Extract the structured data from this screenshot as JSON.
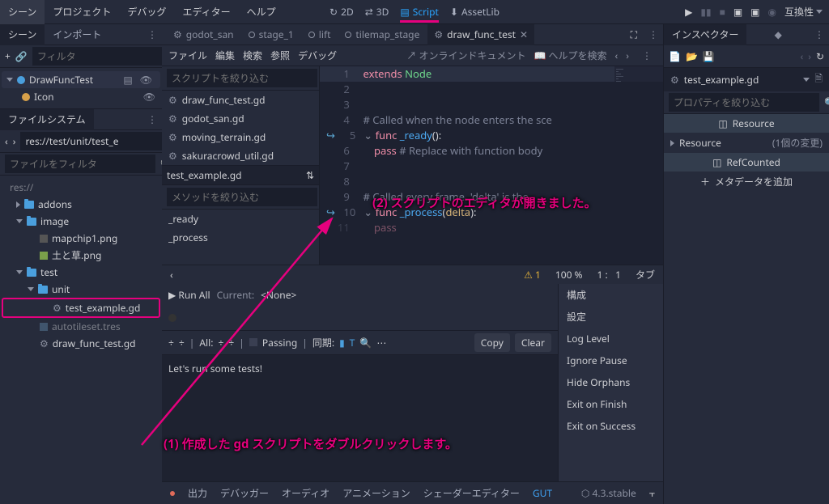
{
  "menu": [
    "シーン",
    "プロジェクト",
    "デバッグ",
    "エディター",
    "ヘルプ"
  ],
  "views": {
    "v2d": "2D",
    "v3d": "3D",
    "script": "Script",
    "assetlib": "AssetLib"
  },
  "compat": "互換性",
  "scene_panel": {
    "tab_scene": "シーン",
    "tab_import": "インポート",
    "filter_ph": "フィルタ",
    "nodes": [
      {
        "name": "DrawFuncTest",
        "icon": "node-blue",
        "sel": true
      },
      {
        "name": "Icon",
        "icon": "sprite",
        "sel": false
      }
    ]
  },
  "fs_panel": {
    "title": "ファイルシステム",
    "path": "res://test/unit/test_e",
    "filter_ph": "ファイルをフィルタ",
    "tree": [
      {
        "t": "folder",
        "name": "addons",
        "d": 1,
        "exp": false
      },
      {
        "t": "folder",
        "name": "image",
        "d": 1,
        "exp": true
      },
      {
        "t": "file",
        "name": "mapchip1.png",
        "d": 2
      },
      {
        "t": "file",
        "name": "土と草.png",
        "d": 2,
        "icon": "img"
      },
      {
        "t": "folder",
        "name": "test",
        "d": 1,
        "exp": true
      },
      {
        "t": "folder",
        "name": "unit",
        "d": 2,
        "exp": true
      },
      {
        "t": "file",
        "name": "test_example.gd",
        "d": 3,
        "icon": "gd",
        "hl": true
      },
      {
        "t": "file",
        "name": "autotileset.tres",
        "d": 2,
        "icon": "res",
        "dim": true
      },
      {
        "t": "file",
        "name": "draw_func_test.gd",
        "d": 2,
        "icon": "gd"
      }
    ]
  },
  "script_tabs": [
    {
      "name": "godot_san",
      "icon": "gd"
    },
    {
      "name": "stage_1",
      "icon": "scene"
    },
    {
      "name": "lift",
      "icon": "scene"
    },
    {
      "name": "tilemap_stage",
      "icon": "scene"
    },
    {
      "name": "draw_func_test",
      "icon": "gd",
      "active": true
    }
  ],
  "se_toolbar": {
    "file": "ファイル",
    "edit": "編集",
    "search": "検索",
    "goto": "参照",
    "debug": "デバッグ",
    "online_doc": "オンラインドキュメント",
    "help_search": "ヘルプを検索"
  },
  "script_side": {
    "filter_scripts_ph": "スクリプトを絞り込む",
    "scripts": [
      "draw_func_test.gd",
      "godot_san.gd",
      "moving_terrain.gd",
      "sakuracrowd_util.gd"
    ],
    "opened": "test_example.gd",
    "filter_methods_ph": "メソッドを絞り込む",
    "methods": [
      "_ready",
      "_process"
    ]
  },
  "code": {
    "lines": [
      {
        "n": 1,
        "html": "<span class='kw'>extends</span> <span class='cls'>Node</span>",
        "hl": true
      },
      {
        "n": 2,
        "html": ""
      },
      {
        "n": 3,
        "html": ""
      },
      {
        "n": 4,
        "html": "<span class='cm'># Called when the node enters the sce</span>"
      },
      {
        "n": 5,
        "html": "<span class='kw'>func</span> <span class='fn'>_ready</span>():",
        "fold": true,
        "conn": true
      },
      {
        "n": 6,
        "html": "    <span class='kw'>pass</span> <span class='cm'># Replace with function body</span>"
      },
      {
        "n": 7,
        "html": ""
      },
      {
        "n": 8,
        "html": ""
      },
      {
        "n": 9,
        "html": "<span class='cm'># Called every frame. 'delta' is the</span>"
      },
      {
        "n": 10,
        "html": "<span class='kw'>func</span> <span class='fn'>_process</span>(<span class='par'>delta</span>):",
        "fold": true,
        "conn": true
      },
      {
        "n": 11,
        "html": "    <span class='kw'>pass</span>",
        "dim": true
      }
    ]
  },
  "status": {
    "warn": "1",
    "zoom": "100 %",
    "line": "1 :",
    "col": "1",
    "tab": "タブ"
  },
  "gut": {
    "run_all": "Run All",
    "current": "Current:",
    "current_val": "<None>",
    "all": "All:",
    "passing": "Passing",
    "sync": "同期:",
    "copy": "Copy",
    "clear": "Clear",
    "msg": "Let's run some tests!",
    "opts": [
      "構成",
      "設定",
      "Log Level",
      "Ignore Pause",
      "Hide Orphans",
      "Exit on Finish",
      "Exit on Success"
    ]
  },
  "bottom": {
    "items": [
      "出力",
      "デバッガー",
      "オーディオ",
      "アニメーション",
      "シェーダーエディター",
      "GUT"
    ],
    "active": 5,
    "version": "4.3.stable"
  },
  "inspector": {
    "title": "インスペクター",
    "script_name": "test_example.gd",
    "filter_ph": "プロパティを絞り込む",
    "resource": "Resource",
    "res_sub": "Resource",
    "res_count": "(1個の変更)",
    "refcounted": "RefCounted",
    "add_meta": "メタデータを追加"
  },
  "annotations": {
    "a1": "(1) 作成した gd スクリプトをダブルクリックします。",
    "a2": "(2) スクリプトのエディタが開きました。"
  }
}
